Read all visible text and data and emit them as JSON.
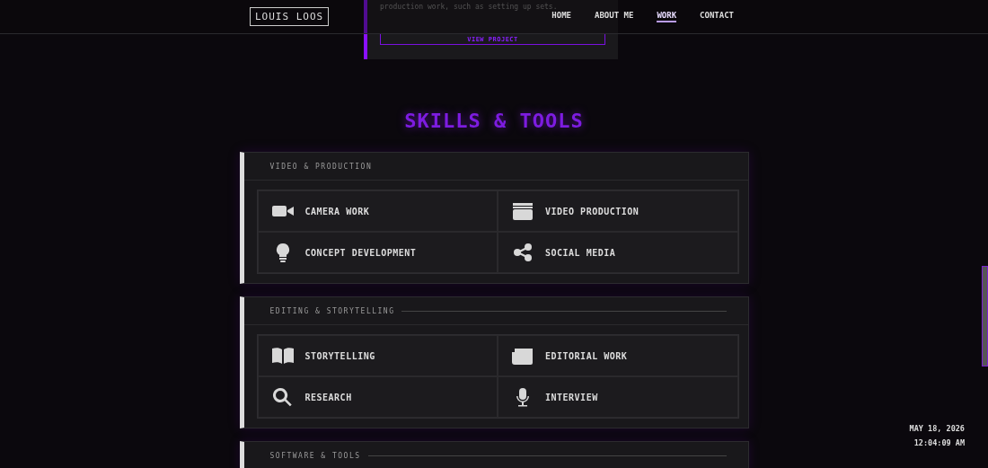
{
  "header": {
    "logo": "LOUIS LOOS",
    "nav": [
      {
        "label": "HOME",
        "selected": false
      },
      {
        "label": "ABOUT ME",
        "selected": false
      },
      {
        "label": "WORK",
        "selected": true
      },
      {
        "label": "CONTACT",
        "selected": false
      }
    ]
  },
  "project_card": {
    "description": "production work, such as setting up sets.",
    "button": "VIEW PROJECT"
  },
  "skills": {
    "title": "SKILLS & TOOLS",
    "groups": [
      {
        "title": "VIDEO & PRODUCTION",
        "title_rule": false,
        "items": [
          {
            "kind": "camera",
            "label": "CAMERA WORK"
          },
          {
            "kind": "clapper",
            "label": "VIDEO PRODUCTION"
          },
          {
            "kind": "bulb",
            "label": "CONCEPT DEVELOPMENT"
          },
          {
            "kind": "share",
            "label": "SOCIAL MEDIA"
          }
        ]
      },
      {
        "title": "EDITING & STORYTELLING",
        "title_rule": true,
        "items": [
          {
            "kind": "book",
            "label": "STORYTELLING"
          },
          {
            "kind": "newspaper",
            "label": "EDITORIAL WORK"
          },
          {
            "kind": "search",
            "label": "RESEARCH"
          },
          {
            "kind": "mic",
            "label": "INTERVIEW"
          }
        ]
      },
      {
        "title": "SOFTWARE & TOOLS",
        "title_rule": true
      }
    ]
  },
  "clock": {
    "date": "MAY 18, 2026",
    "time": "12:04:09 AM"
  }
}
